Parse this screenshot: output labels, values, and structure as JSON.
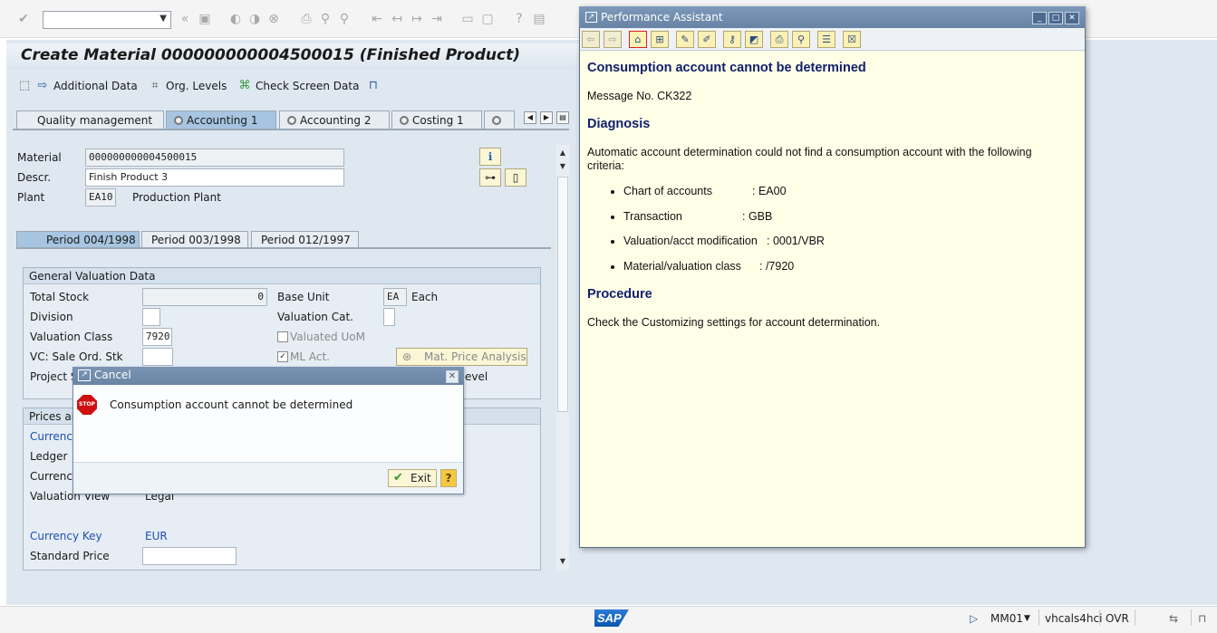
{
  "system_toolbar": {
    "command_field_value": "",
    "icons": [
      "check-icon",
      "back-icon",
      "save-icon",
      "exit-icon",
      "cancel-icon",
      "print-icon",
      "find-icon",
      "find-next-icon",
      "first-page-icon",
      "prev-page-icon",
      "next-page-icon",
      "last-page-icon",
      "new-session-icon",
      "shortcut-icon",
      "help-icon",
      "layout-menu-icon"
    ]
  },
  "screen": {
    "title": "Create Material 000000000004500015 (Finished Product)"
  },
  "app_toolbar": {
    "additional_data": "Additional Data",
    "org_levels": "Org. Levels",
    "check_screen_data": "Check Screen Data"
  },
  "tabs": [
    {
      "label": "Quality management",
      "active": false
    },
    {
      "label": "Accounting 1",
      "active": true
    },
    {
      "label": "Accounting 2",
      "active": false
    },
    {
      "label": "Costing 1",
      "active": false
    }
  ],
  "header": {
    "material_label": "Material",
    "material_value": "000000000004500015",
    "descr_label": "Descr.",
    "descr_value": "Finish Product 3",
    "plant_label": "Plant",
    "plant_value": "EA10",
    "plant_name": "Production Plant"
  },
  "period_tabs": [
    {
      "label": "Period 004/1998",
      "active": true
    },
    {
      "label": "Period 003/1998",
      "active": false
    },
    {
      "label": "Period 012/1997",
      "active": false
    }
  ],
  "general_valuation": {
    "title": "General Valuation Data",
    "total_stock_label": "Total Stock",
    "total_stock_value": "0",
    "base_unit_label": "Base Unit",
    "base_unit_value": "EA",
    "base_unit_text": "Each",
    "division_label": "Division",
    "valuation_cat_label": "Valuation Cat.",
    "valuation_class_label": "Valuation Class",
    "valuation_class_value": "7920",
    "valuated_uom_label": "Valuated UoM",
    "vc_sale_ord_label": "VC: Sale Ord. Stk",
    "ml_act_label": "ML Act.",
    "mat_price_analysis": "Mat. Price Analysis",
    "project_label_partial": "Project S",
    "level_label_partial": "evel"
  },
  "prices": {
    "title_partial": "Prices an",
    "currency_partial": "Currency",
    "ledger_label": "Ledger",
    "currency2_partial": "Currency",
    "valuation_view_label": "Valuation View",
    "valuation_view_value": "Legal",
    "currency_key_label": "Currency Key",
    "currency_key_value": "EUR",
    "standard_price_label": "Standard Price"
  },
  "cancel_dialog": {
    "title": "Cancel",
    "stop_text": "STOP",
    "message": "Consumption account cannot be determined",
    "exit_label": "Exit"
  },
  "performance_assistant": {
    "window_title": "Performance Assistant",
    "heading": "Consumption account cannot be determined",
    "message_no": "Message No. CK322",
    "diagnosis_heading": "Diagnosis",
    "diagnosis_text": "Automatic account determination could not find a consumption account with the following criteria:",
    "criteria": [
      {
        "label": "Chart of accounts",
        "value": ": EA00"
      },
      {
        "label": "Transaction",
        "value": ": GBB"
      },
      {
        "label": "Valuation/acct modification",
        "value": ": 0001/VBR"
      },
      {
        "label": "Material/valuation class",
        "value": ": /7920"
      }
    ],
    "procedure_heading": "Procedure",
    "procedure_text": "Check the Customizing settings for account determination."
  },
  "status_bar": {
    "logo_text": "SAP",
    "transaction": "MM01",
    "server": "vhcals4hci",
    "mode": "OVR"
  }
}
